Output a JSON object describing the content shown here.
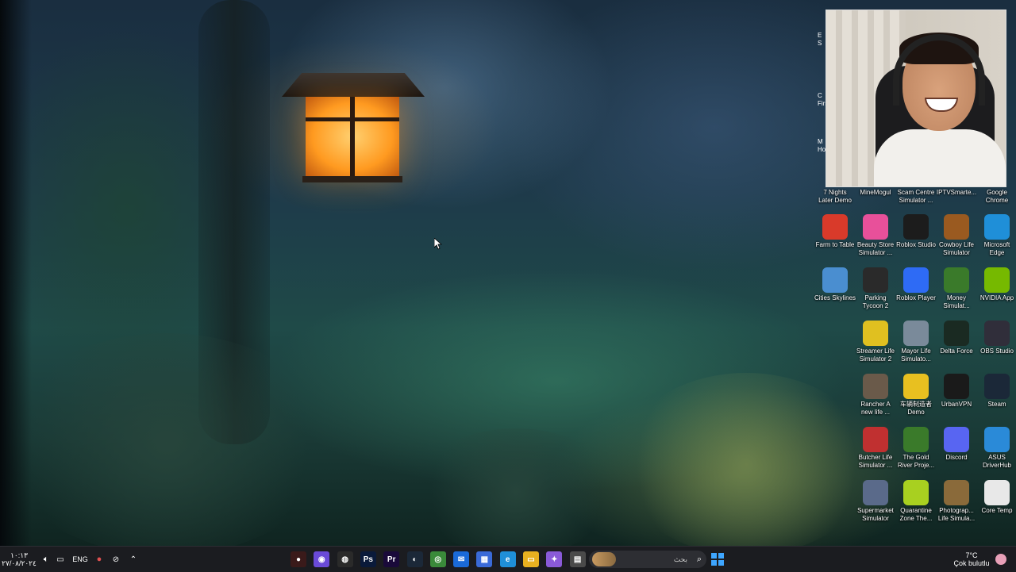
{
  "desktop": {
    "top_row_labels": [
      {
        "name": "7 Nights Later Demo",
        "label": "7 Nights\nLater Demo"
      },
      {
        "name": "MineMogul",
        "label": "MineMogul"
      },
      {
        "name": "Scam Centre Simulator",
        "label": "Scam Centre\nSimulator ..."
      },
      {
        "name": "IPTVSmarters",
        "label": "IPTVSmarte..."
      },
      {
        "name": "Google Chrome",
        "label": "Google\nChrome"
      }
    ],
    "partial_labels": [
      "E",
      "S",
      "C",
      "Firs",
      "M",
      "Ho"
    ],
    "icons": [
      {
        "label": "Farm to Table",
        "icon": "tomato-icon",
        "color": "#d93a2a"
      },
      {
        "label": "Beauty Store Simulator ...",
        "icon": "beauty-store-icon",
        "color": "#e8509a"
      },
      {
        "label": "Roblox Studio",
        "icon": "roblox-studio-icon",
        "color": "#1c1c1c"
      },
      {
        "label": "Cowboy Life Simulator",
        "icon": "cowboy-life-icon",
        "color": "#9a5a20"
      },
      {
        "label": "Microsoft Edge",
        "icon": "edge-icon",
        "color": "#1f8fd8"
      },
      {
        "label": "Cities Skylines",
        "icon": "cities-skylines-icon",
        "color": "#4a8ed0"
      },
      {
        "label": "Parking Tycoon 2",
        "icon": "parking-tycoon-icon",
        "color": "#2a2a2a"
      },
      {
        "label": "Roblox Player",
        "icon": "roblox-player-icon",
        "color": "#2e6bf5"
      },
      {
        "label": "Money Simulat...",
        "icon": "money-simulator-icon",
        "color": "#3a7a2a"
      },
      {
        "label": "NVIDIA App",
        "icon": "nvidia-icon",
        "color": "#76b900"
      },
      {
        "label": "",
        "icon": "blank",
        "color": "transparent"
      },
      {
        "label": "Streamer Life Simulator 2",
        "icon": "streamer-life-icon",
        "color": "#e0c020"
      },
      {
        "label": "Mayor Life Simulato...",
        "icon": "mayor-life-icon",
        "color": "#7a8a9a"
      },
      {
        "label": "Delta Force",
        "icon": "delta-force-icon",
        "color": "#1a2a22"
      },
      {
        "label": "OBS Studio",
        "icon": "obs-icon",
        "color": "#302e3a"
      },
      {
        "label": "",
        "icon": "blank",
        "color": "transparent"
      },
      {
        "label": "Rancher A new life ...",
        "icon": "rancher-icon",
        "color": "#6a5a4a"
      },
      {
        "label": "车辆制造者 Demo",
        "icon": "car-maker-icon",
        "color": "#e8c020"
      },
      {
        "label": "UrbanVPN",
        "icon": "urbanvpn-icon",
        "color": "#1a1a1a"
      },
      {
        "label": "Steam",
        "icon": "steam-icon",
        "color": "#1b2838"
      },
      {
        "label": "",
        "icon": "blank",
        "color": "transparent"
      },
      {
        "label": "Butcher Life Simulator ...",
        "icon": "butcher-life-icon",
        "color": "#c03030"
      },
      {
        "label": "The Gold River Proje...",
        "icon": "gold-river-icon",
        "color": "#3a7a2a"
      },
      {
        "label": "Discord",
        "icon": "discord-icon",
        "color": "#5865f2"
      },
      {
        "label": "ASUS DriverHub",
        "icon": "asus-driverhub-icon",
        "color": "#2a8ad8"
      },
      {
        "label": "",
        "icon": "blank",
        "color": "transparent"
      },
      {
        "label": "Supermarket Simulator",
        "icon": "supermarket-icon",
        "color": "#5a6a8a"
      },
      {
        "label": "Quarantine Zone The...",
        "icon": "quarantine-zone-icon",
        "color": "#a8d020"
      },
      {
        "label": "Photograp... Life Simula...",
        "icon": "photography-life-icon",
        "color": "#8a6a3a"
      },
      {
        "label": "Core Temp",
        "icon": "core-temp-icon",
        "color": "#e8e8e8"
      }
    ]
  },
  "taskbar": {
    "time": "١٠:١٣",
    "date": "٢٧/٠٨/٢٠٢٤",
    "language": "ENG",
    "search_placeholder": "بحث",
    "weather_temp": "7°C",
    "weather_desc": "Çok bulutlu",
    "apps": [
      {
        "name": "recorder",
        "glyph": "●",
        "color": "#3a1a1a"
      },
      {
        "name": "app-purple",
        "glyph": "◉",
        "color": "#6a4ad8"
      },
      {
        "name": "obs",
        "glyph": "◍",
        "color": "#2a2a2a"
      },
      {
        "name": "photoshop",
        "glyph": "Ps",
        "color": "#0a1a3a"
      },
      {
        "name": "premiere",
        "glyph": "Pr",
        "color": "#1a0a3a"
      },
      {
        "name": "steam",
        "glyph": "◐",
        "color": "#1b2838"
      },
      {
        "name": "chrome",
        "glyph": "◎",
        "color": "#3a8a3a"
      },
      {
        "name": "mail",
        "glyph": "✉",
        "color": "#1a6ad8"
      },
      {
        "name": "store",
        "glyph": "▦",
        "color": "#3a6ad8"
      },
      {
        "name": "edge",
        "glyph": "e",
        "color": "#1f8fd8"
      },
      {
        "name": "file-explorer",
        "glyph": "▭",
        "color": "#e8b020"
      },
      {
        "name": "copilot",
        "glyph": "✦",
        "color": "#8a5ad8"
      },
      {
        "name": "notepad",
        "glyph": "▤",
        "color": "#4a4a4a"
      }
    ]
  }
}
